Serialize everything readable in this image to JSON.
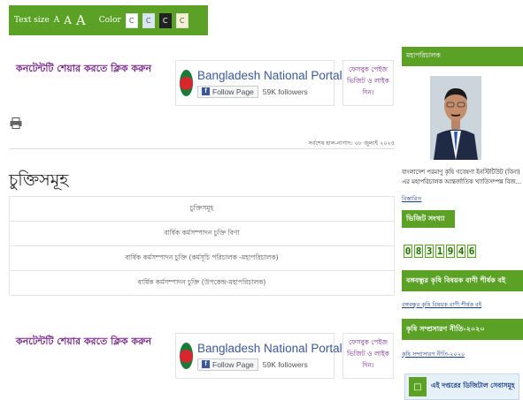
{
  "toolbar": {
    "text_size_label": "Text size",
    "size_small": "A",
    "size_medium": "A",
    "size_large": "A",
    "color_label": "Color",
    "swatches": [
      "C",
      "C",
      "C",
      "C"
    ]
  },
  "share": {
    "label": "কনটেন্টটি শেয়ার করতে ক্লিক করুন"
  },
  "facebook": {
    "page_name": "Bangladesh National Portal",
    "follow_label": "Follow Page",
    "followers": "59K followers",
    "like_prompt": "ফেসবুক পেইজ ভিজিট ও লাইক দিন।"
  },
  "last_update": "সর্বশেষ হাল-নাগাদ: ০৮ জুলাই ২০২৫",
  "main": {
    "title": "চুক্তিসমূহ",
    "table_header": "চুক্তিসমূহ",
    "rows": [
      "বার্ষিক কর্মসম্পাদন চুক্তি বিণা",
      "বার্ষিক কর্মসম্পাদন চুক্তি (কর্মসূচি পরিচালক -মহাপরিচালক)",
      "বার্ষিক কর্মসম্পাদন চুক্তি (উপকেন্দ্র-মহাপরিচালক)"
    ]
  },
  "sidebar": {
    "dg_heading": "মহাপরিচালক",
    "dg_caption": "বাংলাদেশ পরমাণু কৃষি গবেষণা ইনস্টিটিউট (বিনা) এর মহাপরিচালক আন্তর্জাতিক খ্যাতিসম্পন্ন বিজ...",
    "dg_more": "বিস্তারিত",
    "visit_heading": "ভিজিট সংখ্যা",
    "visit_digits": [
      "0",
      "8",
      "3",
      "1",
      "9",
      "4",
      "6"
    ],
    "bangabandhu_heading": "বঙ্গবন্ধুর কৃষি বিষয়ক বাণী শীর্ষক বই",
    "bangabandhu_link": "বঙ্গবন্ধুর কৃষি বিষয়ক বাণী শীর্ষক বই",
    "policy_heading": "কৃষি সম্প্রসারণ নীতি-২০২০",
    "policy_link": "কৃষি সম্প্রসারণ নীতি-২০২০",
    "digital_service": "এই দপ্তরের ডিজিটাল সেবাসমূহ"
  },
  "colors": {
    "brand_green": "#5aa126",
    "share_purple": "#7a2a8c",
    "facebook_blue": "#3b5998"
  }
}
